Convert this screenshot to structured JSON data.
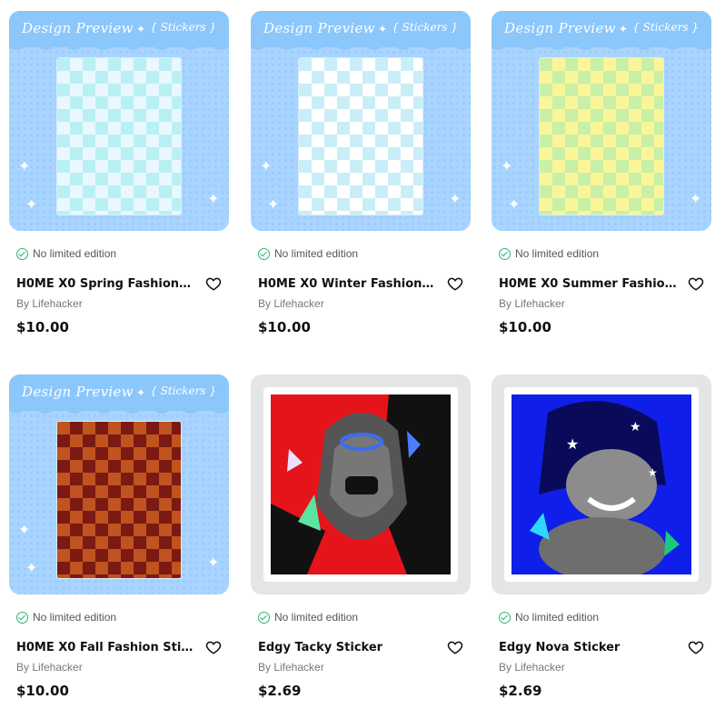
{
  "products": [
    {
      "title": "H0ME X0 Spring Fashion St...",
      "edition": "No limited edition",
      "byline": "By Lifehacker",
      "price": "$10.00",
      "thumb": {
        "type": "design",
        "banner_title": "Design Preview",
        "banner_tag": "{ Stickers }",
        "sheet_colors": [
          "#e9f7ff",
          "#b9f0f4"
        ]
      }
    },
    {
      "title": "H0ME X0 Winter Fashion St...",
      "edition": "No limited edition",
      "byline": "By Lifehacker",
      "price": "$10.00",
      "thumb": {
        "type": "design",
        "banner_title": "Design Preview",
        "banner_tag": "{ Stickers }",
        "sheet_colors": [
          "#ffffff",
          "#c9eef7"
        ]
      }
    },
    {
      "title": "H0ME X0 Summer Fashion ...",
      "edition": "No limited edition",
      "byline": "By Lifehacker",
      "price": "$10.00",
      "thumb": {
        "type": "design",
        "banner_title": "Design Preview",
        "banner_tag": "{ Stickers }",
        "sheet_colors": [
          "#fbf59a",
          "#c8f0a6"
        ]
      }
    },
    {
      "title": "H0ME X0 Fall Fashion Stick...",
      "edition": "No limited edition",
      "byline": "By Lifehacker",
      "price": "$10.00",
      "thumb": {
        "type": "design",
        "banner_title": "Design Preview",
        "banner_tag": "{ Stickers }",
        "sheet_colors": [
          "#7a1a12",
          "#c0531f"
        ]
      }
    },
    {
      "title": "Edgy Tacky Sticker",
      "edition": "No limited edition",
      "byline": "By Lifehacker",
      "price": "$2.69",
      "thumb": {
        "type": "sticker",
        "colors": [
          "#e5141b",
          "#111111",
          "#777777"
        ]
      }
    },
    {
      "title": "Edgy Nova Sticker",
      "edition": "No limited edition",
      "byline": "By Lifehacker",
      "price": "$2.69",
      "thumb": {
        "type": "sticker",
        "colors": [
          "#0f1ee8",
          "#0a0a5a",
          "#9a9a9a"
        ]
      }
    }
  ]
}
